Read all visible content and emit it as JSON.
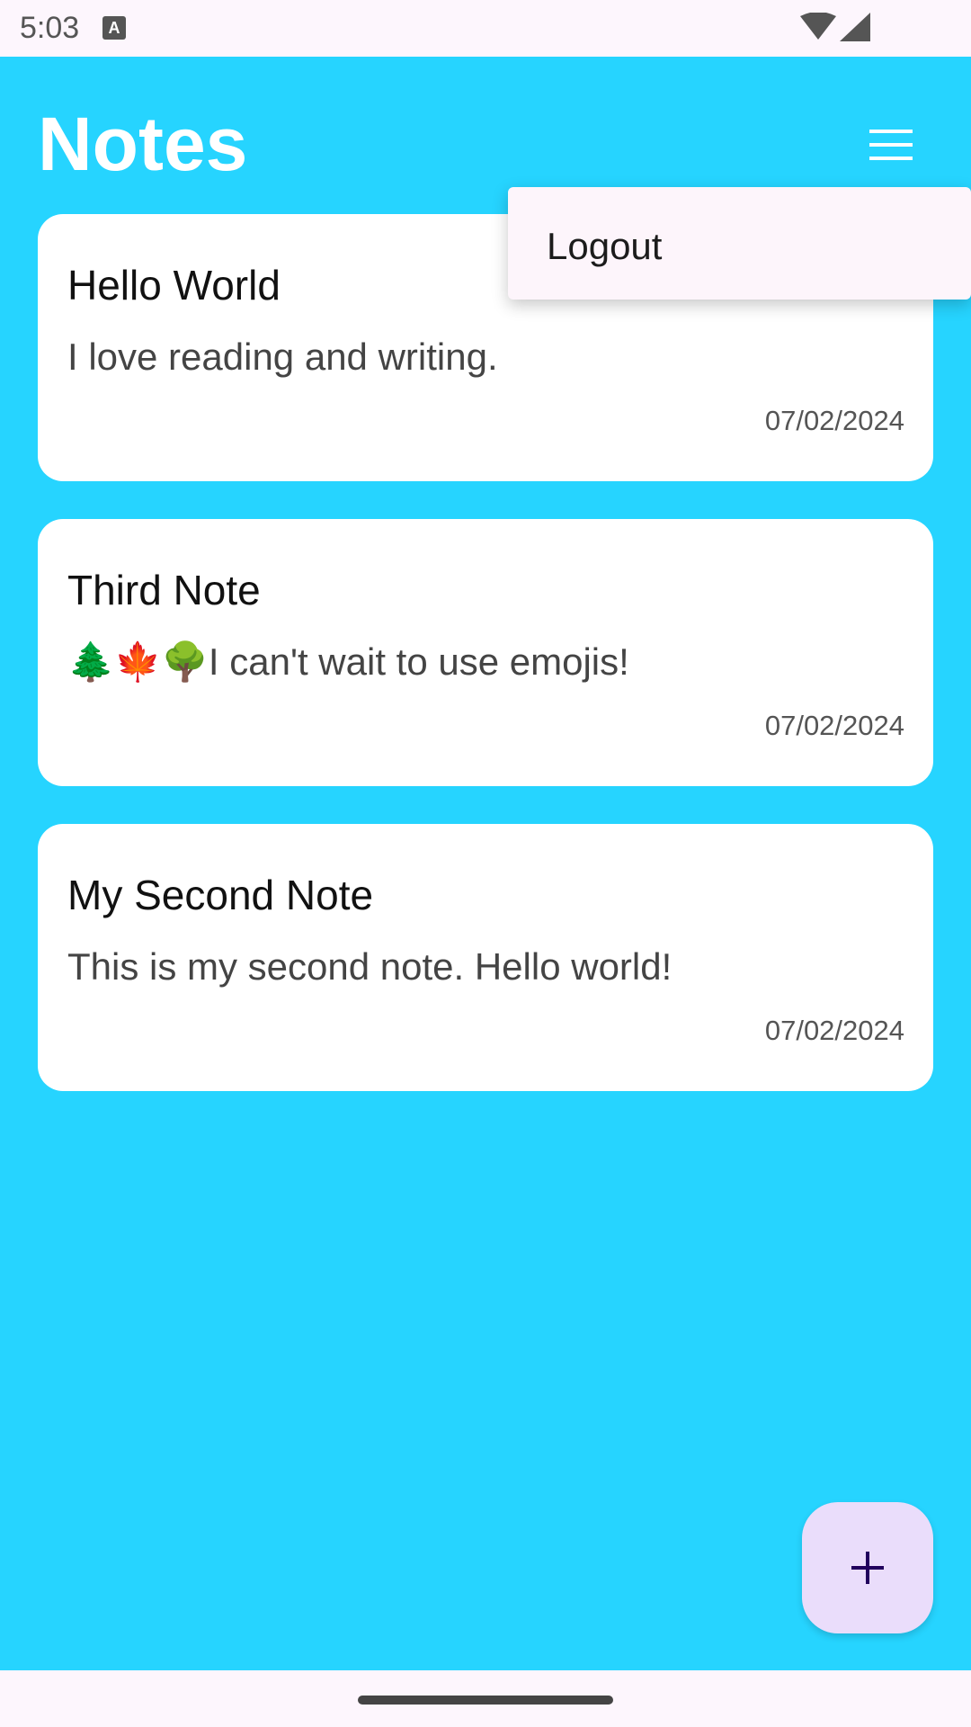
{
  "status_bar": {
    "time": "5:03",
    "notification_icon": "text-a-icon",
    "notification_letter": "A",
    "wifi_icon": "wifi-icon",
    "signal_icon": "cell-signal-icon"
  },
  "header": {
    "title": "Notes",
    "menu_icon": "hamburger-menu-icon"
  },
  "menu": {
    "items": [
      {
        "label": "Logout"
      }
    ]
  },
  "notes": [
    {
      "title": "Hello World",
      "body": "I love reading and writing.",
      "date": "07/02/2024"
    },
    {
      "title": "Third Note",
      "body": "🌲🍁🌳I can't wait to use emojis!",
      "date": "07/02/2024"
    },
    {
      "title": "My Second Note",
      "body": "This is my second note. Hello world!",
      "date": "07/02/2024"
    }
  ],
  "fab": {
    "icon": "plus-icon"
  },
  "colors": {
    "app_background": "#26D4FF",
    "card_background": "#FFFFFF",
    "fab_background": "#EADDFB",
    "fab_icon": "#21005D",
    "menu_background": "#FDF5FB"
  }
}
